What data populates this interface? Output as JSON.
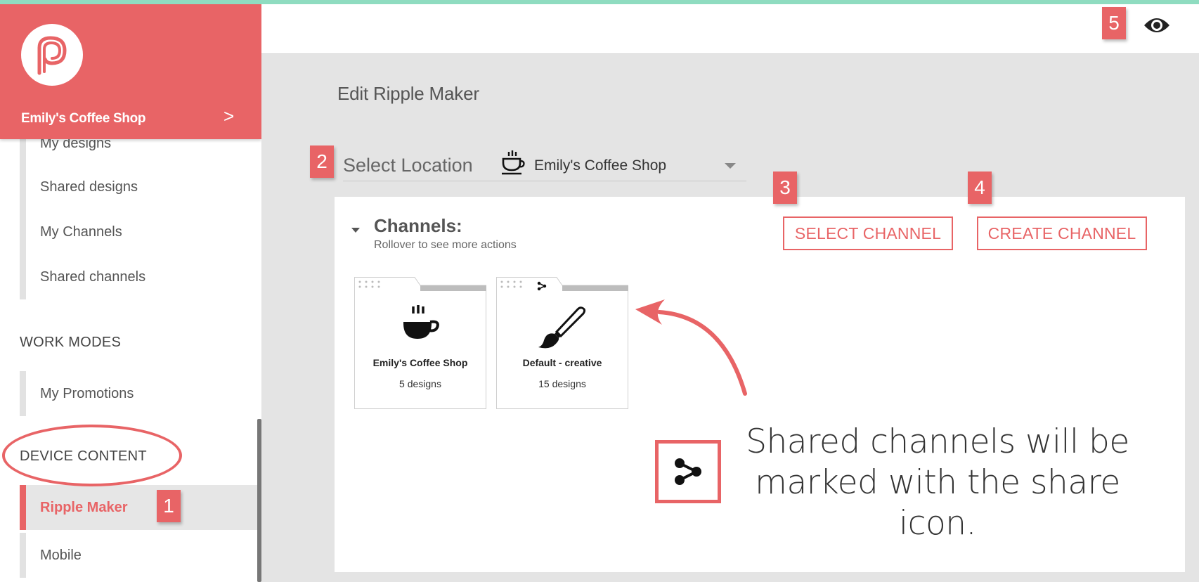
{
  "sidebar": {
    "shop_name": "Emily's Coffee Shop",
    "chevron": ">",
    "partial_item": "My designs",
    "items": [
      {
        "label": "Shared designs"
      },
      {
        "label": "My Channels"
      },
      {
        "label": "Shared channels"
      }
    ],
    "sections": {
      "work_modes": "WORK MODES",
      "device_content": "DEVICE CONTENT"
    },
    "work_mode_items": [
      {
        "label": "My Promotions"
      }
    ],
    "device_items": [
      {
        "label": "Ripple Maker",
        "active": true
      },
      {
        "label": "Mobile"
      }
    ]
  },
  "badges": {
    "b1": "1",
    "b2": "2",
    "b3": "3",
    "b4": "4",
    "b5": "5"
  },
  "header": {
    "eye_icon": "eye-icon"
  },
  "main": {
    "title": "Edit Ripple Maker",
    "location": {
      "label": "Select Location",
      "value": "Emily's Coffee Shop",
      "icon": "coffee-cup-icon"
    },
    "channels": {
      "title": "Channels:",
      "subtitle": "Rollover to see more actions",
      "select_button": "SELECT CHANNEL",
      "create_button": "CREATE CHANNEL",
      "cards": [
        {
          "name": "Emily's Coffee Shop",
          "count": "5 designs",
          "icon": "coffee-cup-icon",
          "shared": false
        },
        {
          "name": "Default - creative",
          "count": "15 designs",
          "icon": "paintbrush-icon",
          "shared": true
        }
      ]
    }
  },
  "annotation": {
    "note": "Shared channels will be marked with the share icon.",
    "icon": "share-icon"
  },
  "colors": {
    "accent": "#e86466",
    "top_strip": "#8fdcc0",
    "background": "#e4e4e4"
  }
}
